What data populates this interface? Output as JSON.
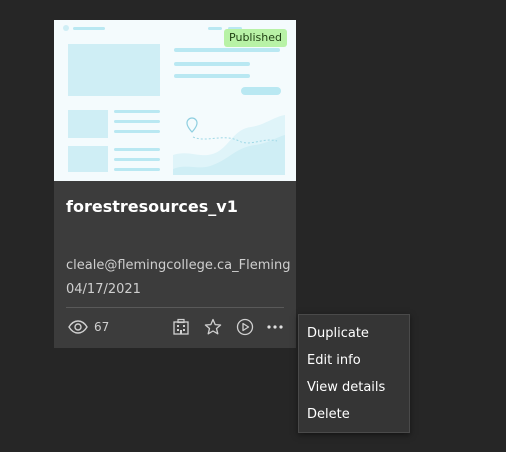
{
  "item": {
    "status_badge": "Published",
    "title": "forestresources_v1",
    "owner": "cleale@flemingcollege.ca_Fleming",
    "modified_date": "04/17/2021",
    "view_count": "67"
  },
  "actions": {
    "icons": [
      "organization-icon",
      "favorite-star-icon",
      "play-icon",
      "more-options-icon"
    ]
  },
  "context_menu": {
    "items": [
      {
        "label": "Duplicate"
      },
      {
        "label": "Edit info"
      },
      {
        "label": "View details"
      },
      {
        "label": "Delete"
      }
    ]
  },
  "colors": {
    "background": "#262626",
    "card": "#3c3c3c",
    "badge": "#b8f2a6",
    "thumbnail_accent": "#b9e8f2"
  }
}
